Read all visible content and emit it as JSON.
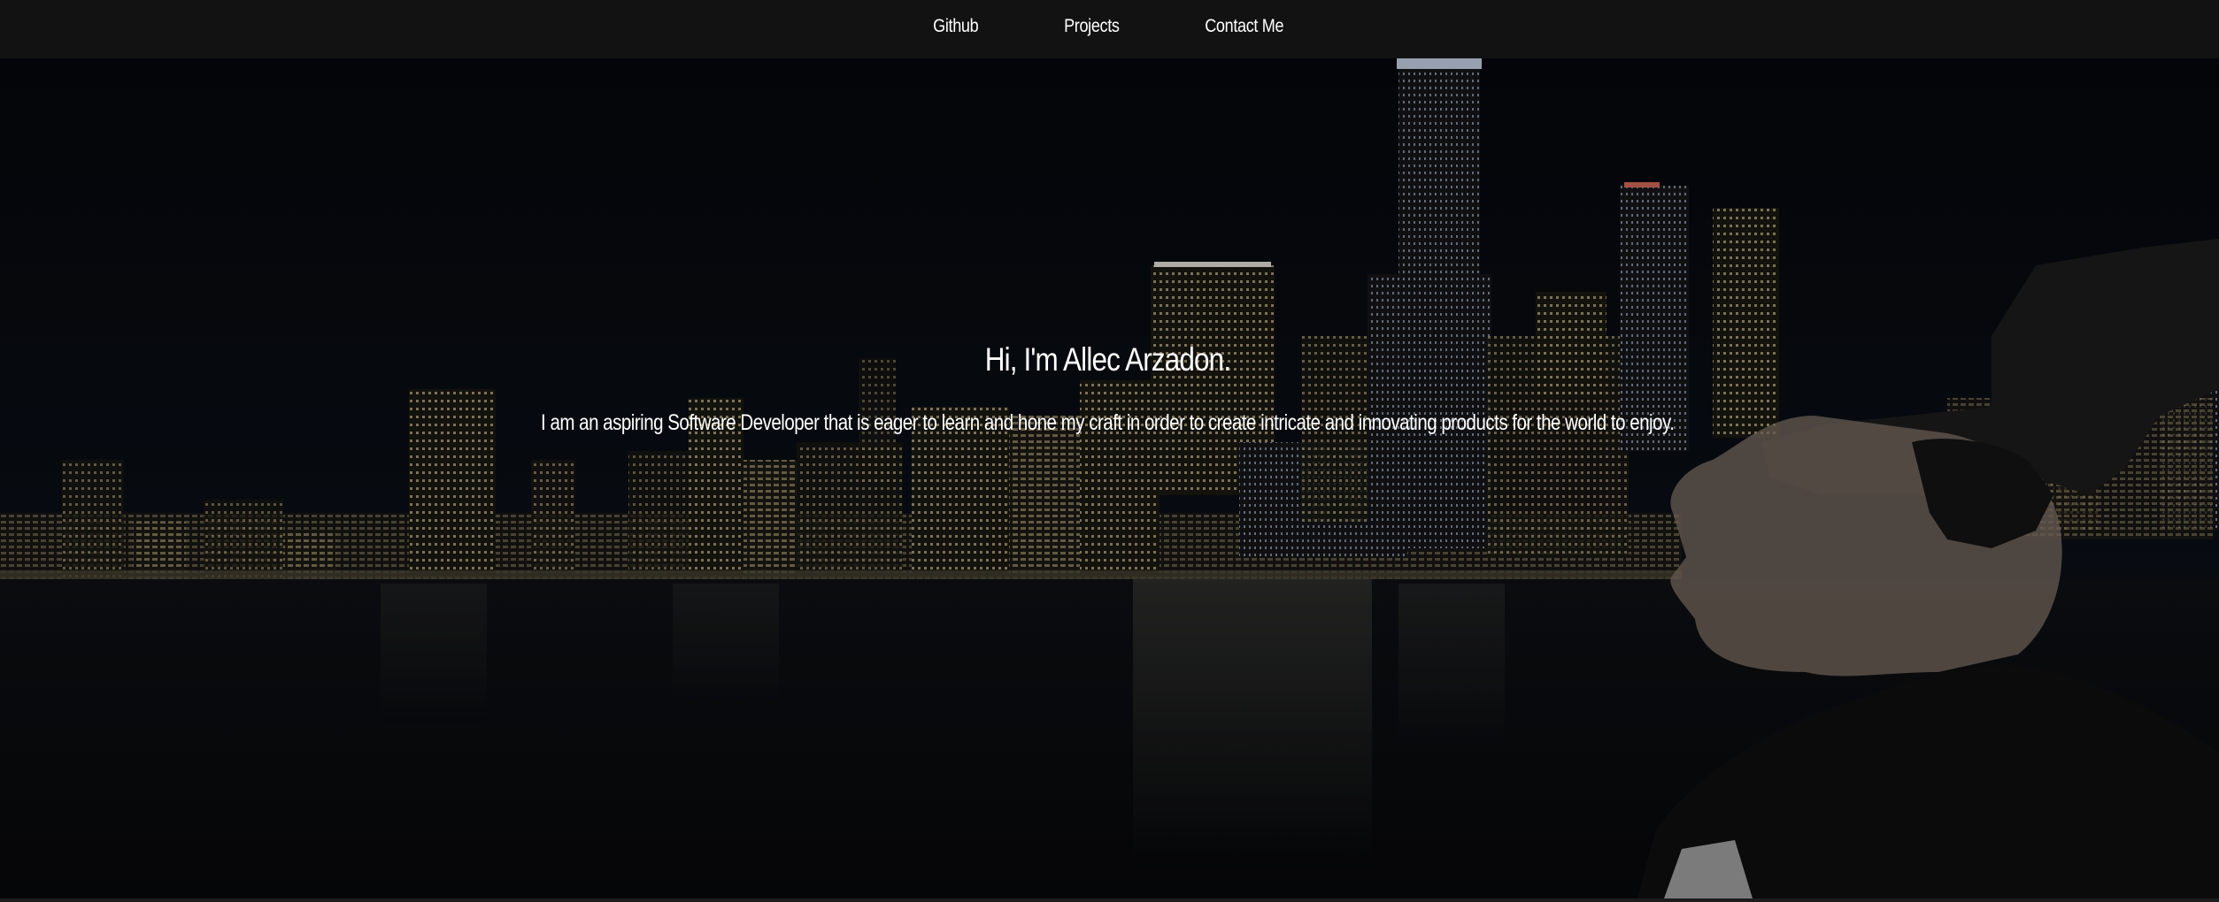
{
  "nav": {
    "items": [
      {
        "label": "Github"
      },
      {
        "label": "Projects"
      },
      {
        "label": "Contact Me"
      }
    ]
  },
  "hero": {
    "title": "Hi, I'm Allec Arzadon.",
    "subtitle": "I am an aspiring Software Developer that is eager to learn and hone my craft in order to create intricate and innovating products for the world to enjoy.",
    "background": "night-city-skyline-photo"
  },
  "colors": {
    "navbar": "#121212",
    "text": "#ffffff",
    "sky": "#06080e",
    "water": "#0a0c10"
  }
}
